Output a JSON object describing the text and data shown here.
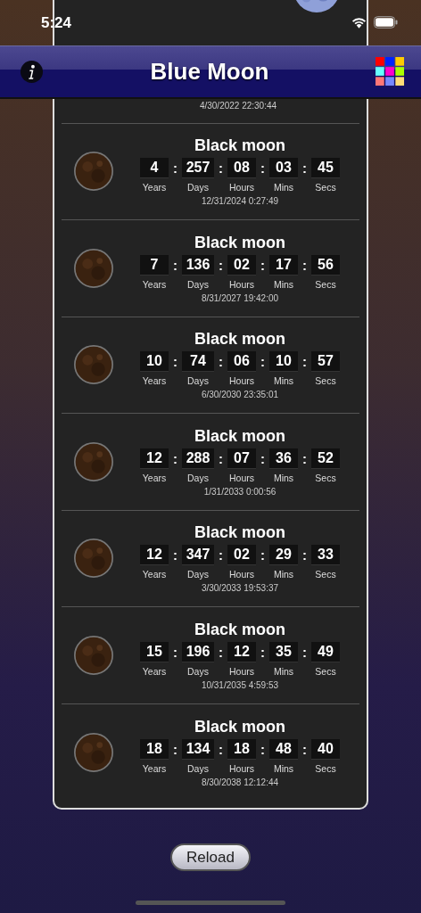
{
  "status_bar": {
    "time": "5:24"
  },
  "nav_bar": {
    "title": "Blue Moon"
  },
  "separator": ":",
  "events": [
    {
      "date": "4/30/2022  22:30:44"
    },
    {
      "title": "Black moon",
      "units": [
        {
          "value": "4",
          "label": "Years"
        },
        {
          "value": "257",
          "label": "Days"
        },
        {
          "value": "08",
          "label": "Hours"
        },
        {
          "value": "03",
          "label": "Mins"
        },
        {
          "value": "45",
          "label": "Secs"
        }
      ],
      "date": "12/31/2024  0:27:49"
    },
    {
      "title": "Black moon",
      "units": [
        {
          "value": "7",
          "label": "Years"
        },
        {
          "value": "136",
          "label": "Days"
        },
        {
          "value": "02",
          "label": "Hours"
        },
        {
          "value": "17",
          "label": "Mins"
        },
        {
          "value": "56",
          "label": "Secs"
        }
      ],
      "date": "8/31/2027  19:42:00"
    },
    {
      "title": "Black moon",
      "units": [
        {
          "value": "10",
          "label": "Years"
        },
        {
          "value": "74",
          "label": "Days"
        },
        {
          "value": "06",
          "label": "Hours"
        },
        {
          "value": "10",
          "label": "Mins"
        },
        {
          "value": "57",
          "label": "Secs"
        }
      ],
      "date": "6/30/2030  23:35:01"
    },
    {
      "title": "Black moon",
      "units": [
        {
          "value": "12",
          "label": "Years"
        },
        {
          "value": "288",
          "label": "Days"
        },
        {
          "value": "07",
          "label": "Hours"
        },
        {
          "value": "36",
          "label": "Mins"
        },
        {
          "value": "52",
          "label": "Secs"
        }
      ],
      "date": "1/31/2033  0:00:56"
    },
    {
      "title": "Black moon",
      "units": [
        {
          "value": "12",
          "label": "Years"
        },
        {
          "value": "347",
          "label": "Days"
        },
        {
          "value": "02",
          "label": "Hours"
        },
        {
          "value": "29",
          "label": "Mins"
        },
        {
          "value": "33",
          "label": "Secs"
        }
      ],
      "date": "3/30/2033  19:53:37"
    },
    {
      "title": "Black moon",
      "units": [
        {
          "value": "15",
          "label": "Years"
        },
        {
          "value": "196",
          "label": "Days"
        },
        {
          "value": "12",
          "label": "Hours"
        },
        {
          "value": "35",
          "label": "Mins"
        },
        {
          "value": "49",
          "label": "Secs"
        }
      ],
      "date": "10/31/2035  4:59:53"
    },
    {
      "title": "Black moon",
      "units": [
        {
          "value": "18",
          "label": "Years"
        },
        {
          "value": "134",
          "label": "Days"
        },
        {
          "value": "18",
          "label": "Hours"
        },
        {
          "value": "48",
          "label": "Mins"
        },
        {
          "value": "40",
          "label": "Secs"
        }
      ],
      "date": "8/30/2038  12:12:44"
    }
  ],
  "reload_button": {
    "label": "Reload"
  }
}
